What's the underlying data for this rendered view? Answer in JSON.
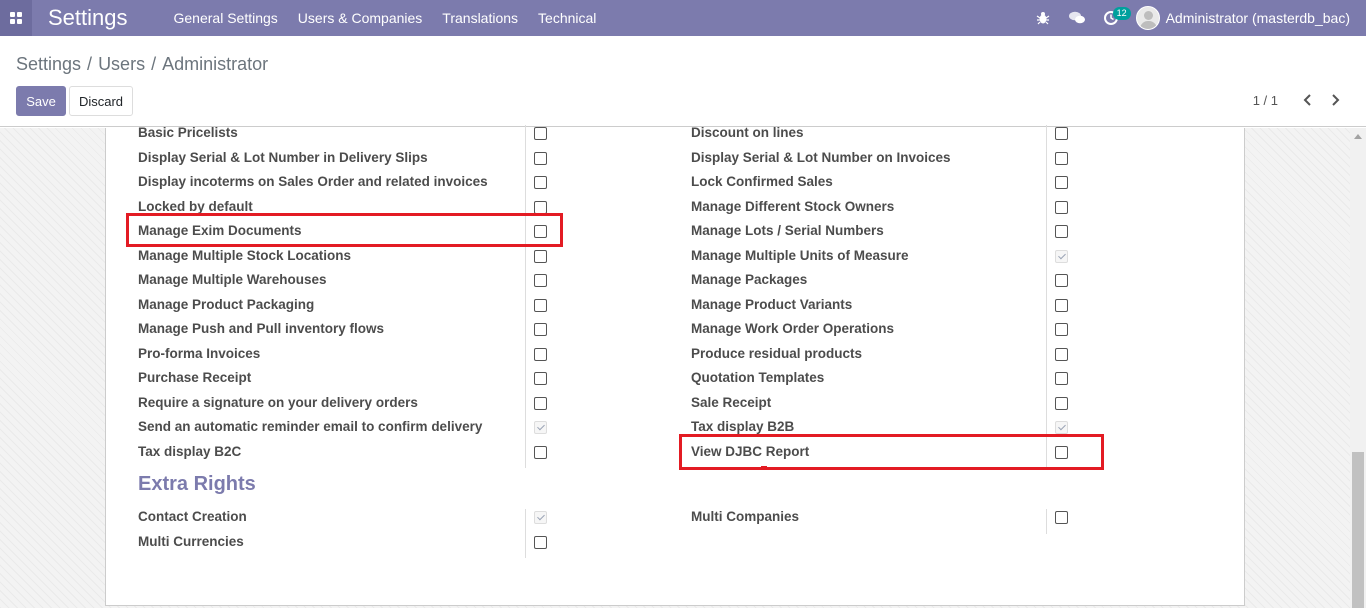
{
  "navbar": {
    "brand": "Settings",
    "menu": [
      "General Settings",
      "Users & Companies",
      "Translations",
      "Technical"
    ],
    "activity_count": "12",
    "user": "Administrator (masterdb_bac)"
  },
  "breadcrumb": [
    "Settings",
    "Users",
    "Administrator"
  ],
  "buttons": {
    "save": "Save",
    "discard": "Discard"
  },
  "pager": "1 / 1",
  "rights": {
    "left": [
      {
        "label": "Basic Pricelists",
        "checked": false
      },
      {
        "label": "Display Serial & Lot Number in Delivery Slips",
        "checked": false
      },
      {
        "label": "Display incoterms on Sales Order and related invoices",
        "checked": false
      },
      {
        "label": "Locked by default",
        "checked": false
      },
      {
        "label": "Manage Exim Documents",
        "checked": false
      },
      {
        "label": "Manage Multiple Stock Locations",
        "checked": false
      },
      {
        "label": "Manage Multiple Warehouses",
        "checked": false
      },
      {
        "label": "Manage Product Packaging",
        "checked": false
      },
      {
        "label": "Manage Push and Pull inventory flows",
        "checked": false
      },
      {
        "label": "Pro-forma Invoices",
        "checked": false
      },
      {
        "label": "Purchase Receipt",
        "checked": false
      },
      {
        "label": "Require a signature on your delivery orders",
        "checked": false
      },
      {
        "label": "Send an automatic reminder email to confirm delivery",
        "checked": true
      },
      {
        "label": "Tax display B2C",
        "checked": false
      }
    ],
    "right": [
      {
        "label": "Discount on lines",
        "checked": false
      },
      {
        "label": "Display Serial & Lot Number on Invoices",
        "checked": false
      },
      {
        "label": "Lock Confirmed Sales",
        "checked": false
      },
      {
        "label": "Manage Different Stock Owners",
        "checked": false
      },
      {
        "label": "Manage Lots / Serial Numbers",
        "checked": false
      },
      {
        "label": "Manage Multiple Units of Measure",
        "checked": true
      },
      {
        "label": "Manage Packages",
        "checked": false
      },
      {
        "label": "Manage Product Variants",
        "checked": false
      },
      {
        "label": "Manage Work Order Operations",
        "checked": false
      },
      {
        "label": "Produce residual products",
        "checked": false
      },
      {
        "label": "Quotation Templates",
        "checked": false
      },
      {
        "label": "Sale Receipt",
        "checked": false
      },
      {
        "label": "Tax display B2B",
        "checked": true
      },
      {
        "label": "View DJBC Report",
        "checked": false
      }
    ]
  },
  "extra_rights": {
    "title": "Extra Rights",
    "left": [
      {
        "label": "Contact Creation",
        "checked": true
      },
      {
        "label": "Multi Currencies",
        "checked": false
      }
    ],
    "right": [
      {
        "label": "Multi Companies",
        "checked": false
      }
    ]
  },
  "colors": {
    "primary": "#7c7bad",
    "highlight": "#e31b23",
    "badge": "#00a09d"
  }
}
